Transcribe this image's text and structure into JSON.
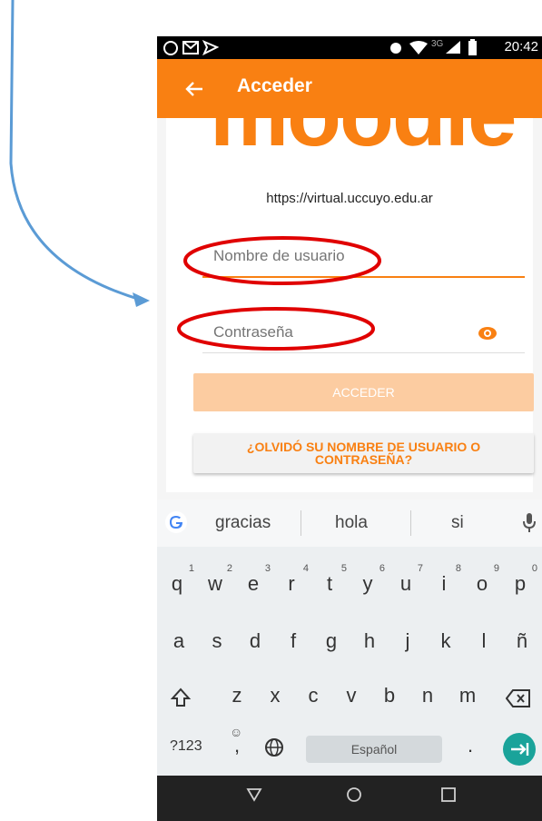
{
  "status": {
    "network": "3G",
    "time": "20:42"
  },
  "appbar": {
    "title": "Acceder",
    "back_icon": "arrow-left-icon"
  },
  "logo_text": "moodle",
  "site_url": "https://virtual.uccuyo.edu.ar",
  "form": {
    "username_placeholder": "Nombre de usuario",
    "password_placeholder": "Contraseña",
    "login_label": "ACCEDER",
    "forgot_label": "¿OLVIDÓ SU NOMBRE DE USUARIO O CONTRASEÑA?"
  },
  "keyboard": {
    "suggestions": [
      "gracias",
      "hola",
      "si"
    ],
    "row1": [
      [
        "q",
        "1"
      ],
      [
        "w",
        "2"
      ],
      [
        "e",
        "3"
      ],
      [
        "r",
        "4"
      ],
      [
        "t",
        "5"
      ],
      [
        "y",
        "6"
      ],
      [
        "u",
        "7"
      ],
      [
        "i",
        "8"
      ],
      [
        "o",
        "9"
      ],
      [
        "p",
        "0"
      ]
    ],
    "row2": [
      "a",
      "s",
      "d",
      "f",
      "g",
      "h",
      "j",
      "k",
      "l",
      "ñ"
    ],
    "row3": [
      "z",
      "x",
      "c",
      "v",
      "b",
      "n",
      "m"
    ],
    "symbols_label": "?123",
    "comma_label": ",",
    "space_label": "Español",
    "period_label": "."
  },
  "colors": {
    "accent": "#f98012",
    "annotation": "#e00000",
    "arrow": "#5b9bd5"
  }
}
